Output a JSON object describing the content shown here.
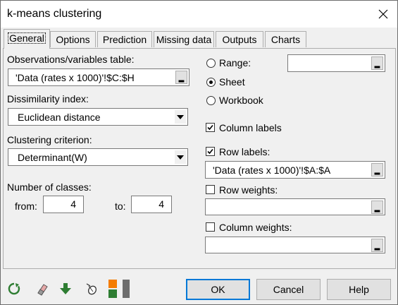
{
  "window": {
    "title": "k-means clustering"
  },
  "tabs": [
    {
      "label": "General"
    },
    {
      "label": "Options"
    },
    {
      "label": "Prediction"
    },
    {
      "label": "Missing data"
    },
    {
      "label": "Outputs"
    },
    {
      "label": "Charts"
    }
  ],
  "general": {
    "observations_label": "Observations/variables table:",
    "observations_value": "'Data (rates x 1000)'!$C:$H",
    "dissimilarity_label": "Dissimilarity index:",
    "dissimilarity_value": "Euclidean distance",
    "criterion_label": "Clustering criterion:",
    "criterion_value": "Determinant(W)",
    "classes_label": "Number of classes:",
    "from_label": "from:",
    "from_value": "4",
    "to_label": "to:",
    "to_value": "4"
  },
  "range_options": {
    "range_label": "Range:",
    "range_value": "",
    "sheet_label": "Sheet",
    "workbook_label": "Workbook",
    "selected": "Sheet"
  },
  "checks": {
    "column_labels": {
      "label": "Column labels",
      "checked": true
    },
    "row_labels": {
      "label": "Row labels:",
      "checked": true,
      "value": "'Data (rates x 1000)'!$A:$A"
    },
    "row_weights": {
      "label": "Row weights:",
      "checked": false,
      "value": ""
    },
    "column_weights": {
      "label": "Column weights:",
      "checked": false,
      "value": ""
    }
  },
  "footer": {
    "ok_label": "OK",
    "cancel_label": "Cancel",
    "help_label": "Help",
    "icons": [
      "reset-icon",
      "eraser-icon",
      "download-icon",
      "mouse-icon",
      "colors-icon"
    ]
  },
  "colors": {
    "accent": "#0078d7",
    "green": "#2e7d32",
    "orange": "#f57c00"
  }
}
